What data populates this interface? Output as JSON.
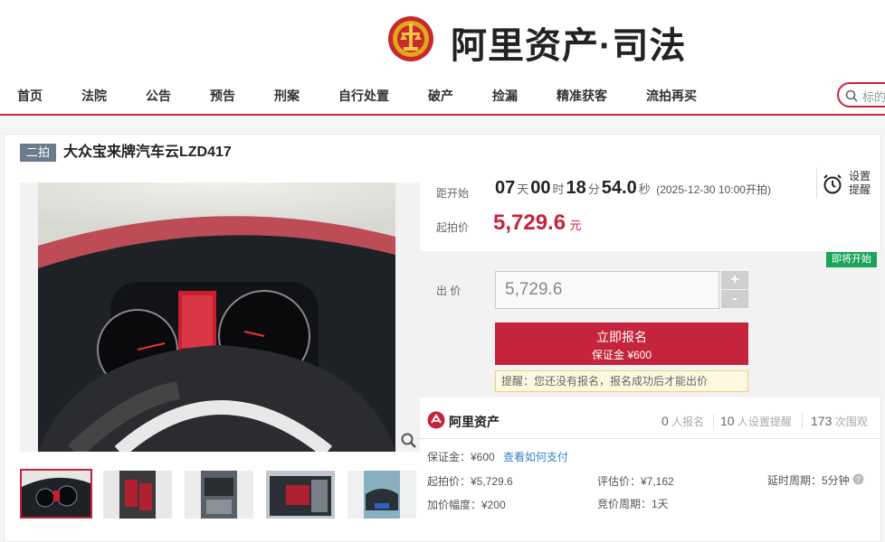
{
  "header": {
    "logo_text": "阿里资产·司法"
  },
  "nav": {
    "items": [
      "首页",
      "法院",
      "公告",
      "预告",
      "刑案",
      "自行处置",
      "破产",
      "捡漏",
      "精准获客",
      "流拍再买"
    ],
    "search_placeholder": "标的"
  },
  "item": {
    "badge": "二拍",
    "title": "大众宝来牌汽车云LZD417"
  },
  "countdown": {
    "label": "距开始",
    "days": "07",
    "days_unit": "天",
    "hours": "00",
    "hours_unit": "时",
    "minutes": "18",
    "minutes_unit": "分",
    "seconds": "54.0",
    "seconds_unit": "秒",
    "start_note": "(2025-12-30 10:00开拍)"
  },
  "reminder": {
    "line1": "设置",
    "line2": "提醒"
  },
  "start_price": {
    "label": "起拍价",
    "value": "5,729.6",
    "unit": "元"
  },
  "bid": {
    "status_tag": "即将开始",
    "label": "出 价",
    "input_value": "5,729.6",
    "plus": "+",
    "minus": "-",
    "apply_label": "立即报名",
    "deposit_note": "保证金 ¥600",
    "tip": "提醒：您还没有报名，报名成功后才能出价"
  },
  "stats": {
    "brand": "阿里资产",
    "signups": "0",
    "signups_label": "人报名",
    "reminders": "10",
    "reminders_label": "人设置提醒",
    "views": "173",
    "views_label": "次围观"
  },
  "details": {
    "deposit": "保证金：¥600",
    "how_to_pay": "查看如何支付",
    "start_price": "起拍价：¥5,729.6",
    "assessed": "评估价：¥7,162",
    "delay": "延时周期：5分钟",
    "increment": "加价幅度：¥200",
    "bid_cycle": "竞价周期：1天"
  },
  "colors": {
    "brand_red": "#c4243c",
    "green_tag": "#1aa45a",
    "badge_gray": "#6a7b8c"
  }
}
